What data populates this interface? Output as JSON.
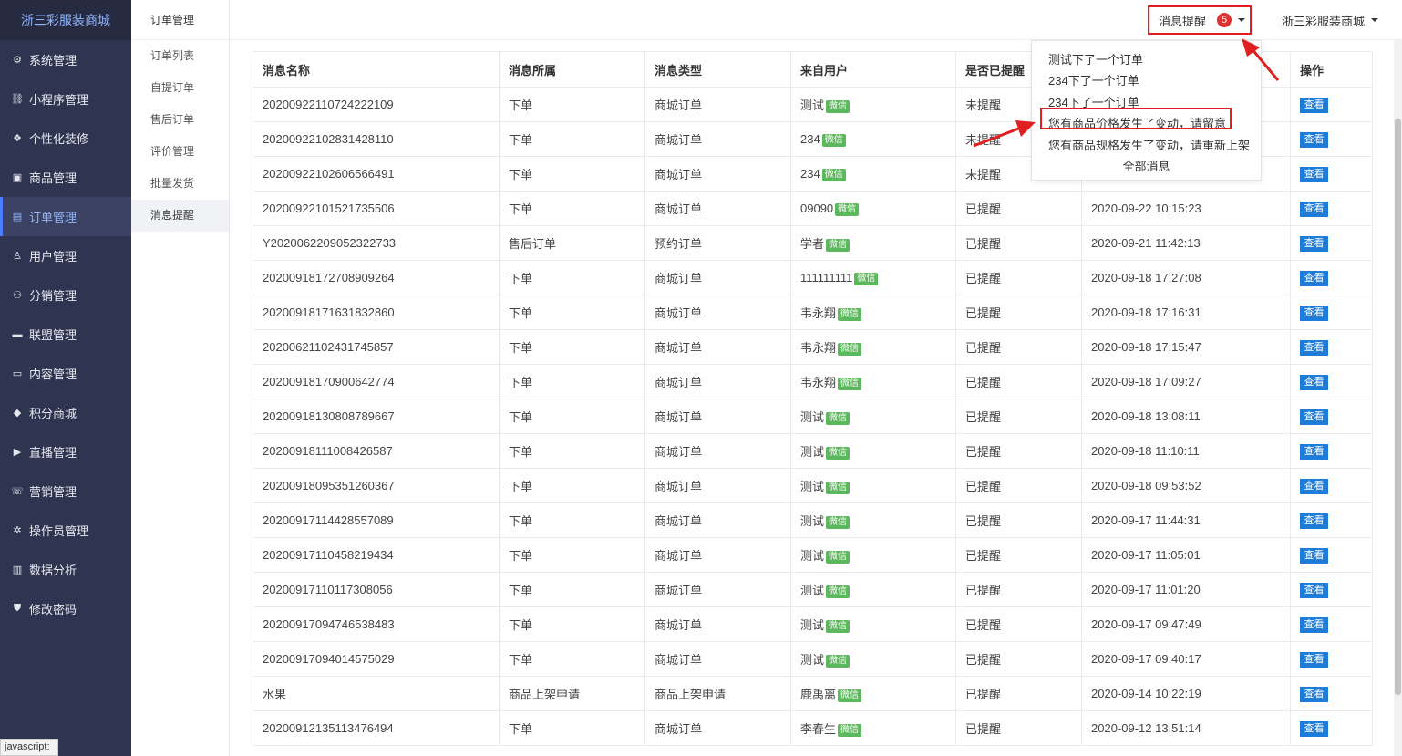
{
  "brand": "浙三彩服装商城",
  "sidebar": {
    "items": [
      {
        "label": "系统管理",
        "icon": "gear-icon",
        "glyph": "⚙"
      },
      {
        "label": "小程序管理",
        "icon": "link-icon",
        "glyph": "⛓"
      },
      {
        "label": "个性化装修",
        "icon": "diamond-icon",
        "glyph": "❖"
      },
      {
        "label": "商品管理",
        "icon": "shopping-bag-icon",
        "glyph": "▣"
      },
      {
        "label": "订单管理",
        "icon": "document-icon",
        "glyph": "▤"
      },
      {
        "label": "用户管理",
        "icon": "user-icon",
        "glyph": "♙"
      },
      {
        "label": "分销管理",
        "icon": "network-icon",
        "glyph": "⚇"
      },
      {
        "label": "联盟管理",
        "icon": "card-icon",
        "glyph": "▬"
      },
      {
        "label": "内容管理",
        "icon": "content-icon",
        "glyph": "▭"
      },
      {
        "label": "积分商城",
        "icon": "cube-icon",
        "glyph": "◆"
      },
      {
        "label": "直播管理",
        "icon": "play-icon",
        "glyph": "▶"
      },
      {
        "label": "营销管理",
        "icon": "marketing-icon",
        "glyph": "☏"
      },
      {
        "label": "操作员管理",
        "icon": "cog-icon",
        "glyph": "✲"
      },
      {
        "label": "数据分析",
        "icon": "bar-chart-icon",
        "glyph": "▥"
      },
      {
        "label": "修改密码",
        "icon": "shield-icon",
        "glyph": "⛊"
      }
    ]
  },
  "subnav": {
    "title": "订单管理",
    "items": [
      "订单列表",
      "自提订单",
      "售后订单",
      "评价管理",
      "批量发货",
      "消息提醒"
    ]
  },
  "topbar": {
    "notif_label": "消息提醒",
    "notif_count": "5",
    "user_label": "浙三彩服装商城"
  },
  "dropdown": {
    "items": [
      "测试下了一个订单",
      "234下了一个订单",
      "234下了一个订单",
      "您有商品价格发生了变动，请留意",
      "您有商品规格发生了变动，请重新上架"
    ],
    "all_label": "全部消息"
  },
  "table": {
    "headers": [
      "消息名称",
      "消息所属",
      "消息类型",
      "来自用户",
      "是否已提醒",
      "",
      "操作"
    ],
    "wx_tag": "微信",
    "view_label": "查看",
    "rows": [
      [
        "20200922110724222109",
        "下单",
        "商城订单",
        "测试",
        "未提醒",
        ""
      ],
      [
        "20200922102831428110",
        "下单",
        "商城订单",
        "234",
        "未提醒",
        ""
      ],
      [
        "20200922102606566491",
        "下单",
        "商城订单",
        "234",
        "未提醒",
        ""
      ],
      [
        "20200922101521735506",
        "下单",
        "商城订单",
        "09090",
        "已提醒",
        "2020-09-22 10:15:23"
      ],
      [
        "Y2020062209052322733",
        "售后订单",
        "预约订单",
        "学者",
        "已提醒",
        "2020-09-21 11:42:13"
      ],
      [
        "20200918172708909264",
        "下单",
        "商城订单",
        "111111111",
        "已提醒",
        "2020-09-18 17:27:08"
      ],
      [
        "20200918171631832860",
        "下单",
        "商城订单",
        "韦永翔",
        "已提醒",
        "2020-09-18 17:16:31"
      ],
      [
        "20200621102431745857",
        "下单",
        "商城订单",
        "韦永翔",
        "已提醒",
        "2020-09-18 17:15:47"
      ],
      [
        "20200918170900642774",
        "下单",
        "商城订单",
        "韦永翔",
        "已提醒",
        "2020-09-18 17:09:27"
      ],
      [
        "20200918130808789667",
        "下单",
        "商城订单",
        "测试",
        "已提醒",
        "2020-09-18 13:08:11"
      ],
      [
        "20200918111008426587",
        "下单",
        "商城订单",
        "测试",
        "已提醒",
        "2020-09-18 11:10:11"
      ],
      [
        "20200918095351260367",
        "下单",
        "商城订单",
        "测试",
        "已提醒",
        "2020-09-18 09:53:52"
      ],
      [
        "20200917114428557089",
        "下单",
        "商城订单",
        "测试",
        "已提醒",
        "2020-09-17 11:44:31"
      ],
      [
        "20200917110458219434",
        "下单",
        "商城订单",
        "测试",
        "已提醒",
        "2020-09-17 11:05:01"
      ],
      [
        "20200917110117308056",
        "下单",
        "商城订单",
        "测试",
        "已提醒",
        "2020-09-17 11:01:20"
      ],
      [
        "20200917094746538483",
        "下单",
        "商城订单",
        "测试",
        "已提醒",
        "2020-09-17 09:47:49"
      ],
      [
        "20200917094014575029",
        "下单",
        "商城订单",
        "测试",
        "已提醒",
        "2020-09-17 09:40:17"
      ],
      [
        "水果",
        "商品上架申请",
        "商品上架申请",
        "鹿禹离",
        "已提醒",
        "2020-09-14 10:22:19"
      ],
      [
        "20200912135113476494",
        "下单",
        "商城订单",
        "李春生",
        "已提醒",
        "2020-09-12 13:51:14"
      ]
    ]
  },
  "statusbar": "javascript:",
  "colors": {
    "sidebar": "#2f3550",
    "accent": "#1f7bd8",
    "annotation": "#e02020",
    "wechat_tag": "#5cb85c"
  }
}
